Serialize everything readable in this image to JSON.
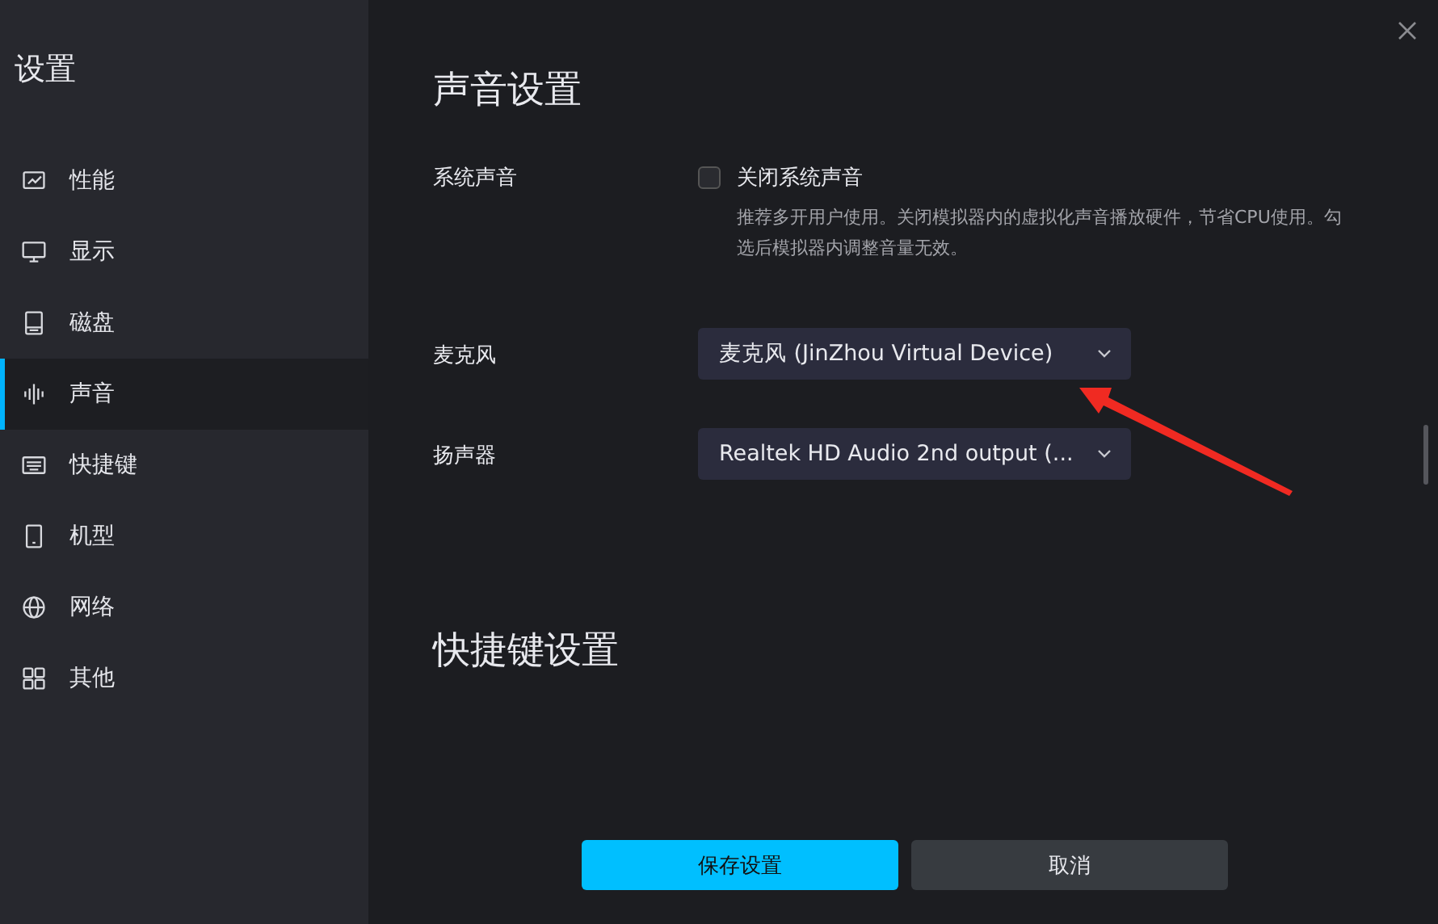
{
  "sidebar": {
    "title": "设置",
    "items": [
      {
        "label": "性能",
        "selected": false
      },
      {
        "label": "显示",
        "selected": false
      },
      {
        "label": "磁盘",
        "selected": false
      },
      {
        "label": "声音",
        "selected": true
      },
      {
        "label": "快捷键",
        "selected": false
      },
      {
        "label": "机型",
        "selected": false
      },
      {
        "label": "网络",
        "selected": false
      },
      {
        "label": "其他",
        "selected": false
      }
    ]
  },
  "sections": [
    {
      "heading": "声音设置",
      "rows": [
        {
          "kind": "checkbox",
          "label": "系统声音",
          "option": "关闭系统声音",
          "checked": false,
          "hint": "推荐多开用户使用。关闭模拟器内的虚拟化声音播放硬件，节省CPU使用。勾选后模拟器内调整音量无效。"
        },
        {
          "kind": "dropdown",
          "label": "麦克风",
          "value": "麦克风 (JinZhou Virtual Device)"
        },
        {
          "kind": "dropdown",
          "label": "扬声器",
          "value": "Realtek HD Audio 2nd output (..."
        }
      ]
    },
    {
      "heading": "快捷键设置"
    }
  ],
  "buttons": [
    {
      "label": "保存设置",
      "kind": "primary"
    },
    {
      "label": "取消",
      "kind": "secondary"
    }
  ]
}
